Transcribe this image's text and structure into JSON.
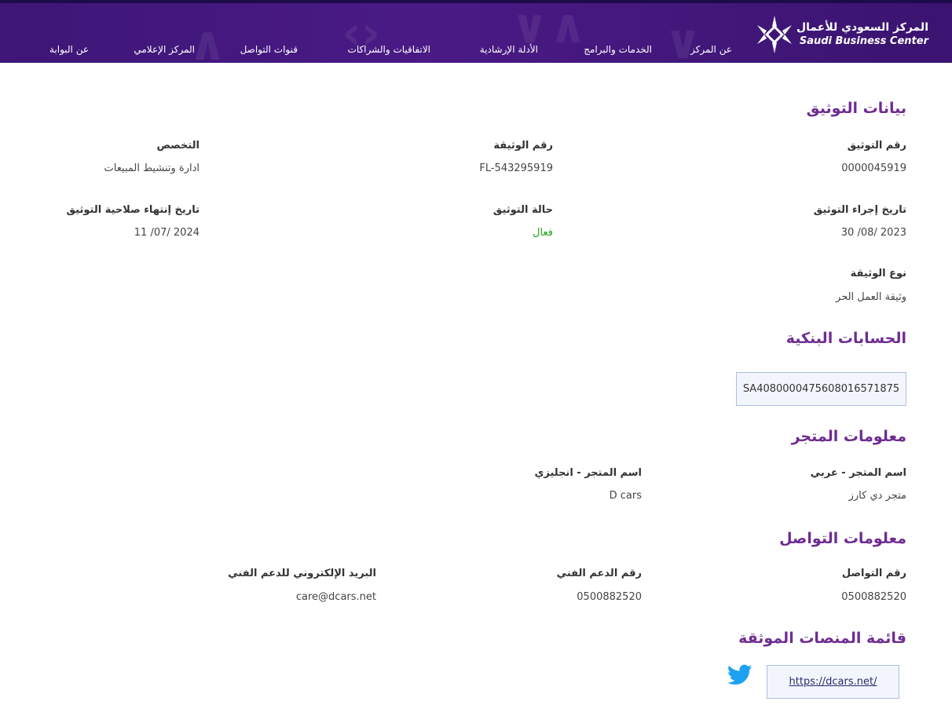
{
  "header": {
    "logo_ar": "المركز السعودي للأعمال",
    "logo_en": "Saudi Business Center",
    "nav": [
      "عن المركز",
      "الخدمات والبرامج",
      "الأدلة الإرشادية",
      "الاتفاقيات والشراكات",
      "قنوات التواصل",
      "المركز الإعلامي",
      "عن البوابة"
    ]
  },
  "certification": {
    "title": "بيانات التوثيق",
    "cert_number_label": "رقم التوثيق",
    "cert_number_value": "0000045919",
    "doc_number_label": "رقم الوثيقة",
    "doc_number_value": "FL-543295919",
    "specialization_label": "التخصص",
    "specialization_value": "ادارة وتنشيط المبيعات",
    "cert_date_label": "تاريخ إجراء التوثيق",
    "cert_date_value": "2023 /08/ 30",
    "status_label": "حالة التوثيق",
    "status_value": "فعال",
    "expiry_label": "تاريخ إنتهاء صلاحية التوثيق",
    "expiry_value": "2024 /07/ 11",
    "doc_type_label": "نوع الوثيقة",
    "doc_type_value": "وثيقة العمل الحر",
    "status_color": "#22a318"
  },
  "bank": {
    "title": "الحسابات البنكية",
    "iban": "SA4080000475608016571875"
  },
  "store": {
    "title": "معلومات المتجر",
    "name_ar_label": "اسم المتجر - عربي",
    "name_ar_value": "متجر دي كارز",
    "name_en_label": "اسم المتجر - انجليزي",
    "name_en_value": "D cars"
  },
  "contact": {
    "title": "معلومات التواصل",
    "phone_label": "رقم التواصل",
    "phone_value": "0500882520",
    "support_label": "رقم الدعم الفني",
    "support_value": "0500882520",
    "email_label": "البريد الإلكتروني للدعم الفني",
    "email_value": "care@dcars.net"
  },
  "platforms": {
    "title": "قائمة المنصات الموثقة",
    "items": [
      {
        "icon": "twitter-icon",
        "url": "https://dcars.net/"
      }
    ]
  },
  "colors": {
    "header_bg": "#4a1a85",
    "section_title": "#6f2c91",
    "twitter_blue": "#1da1f2"
  }
}
